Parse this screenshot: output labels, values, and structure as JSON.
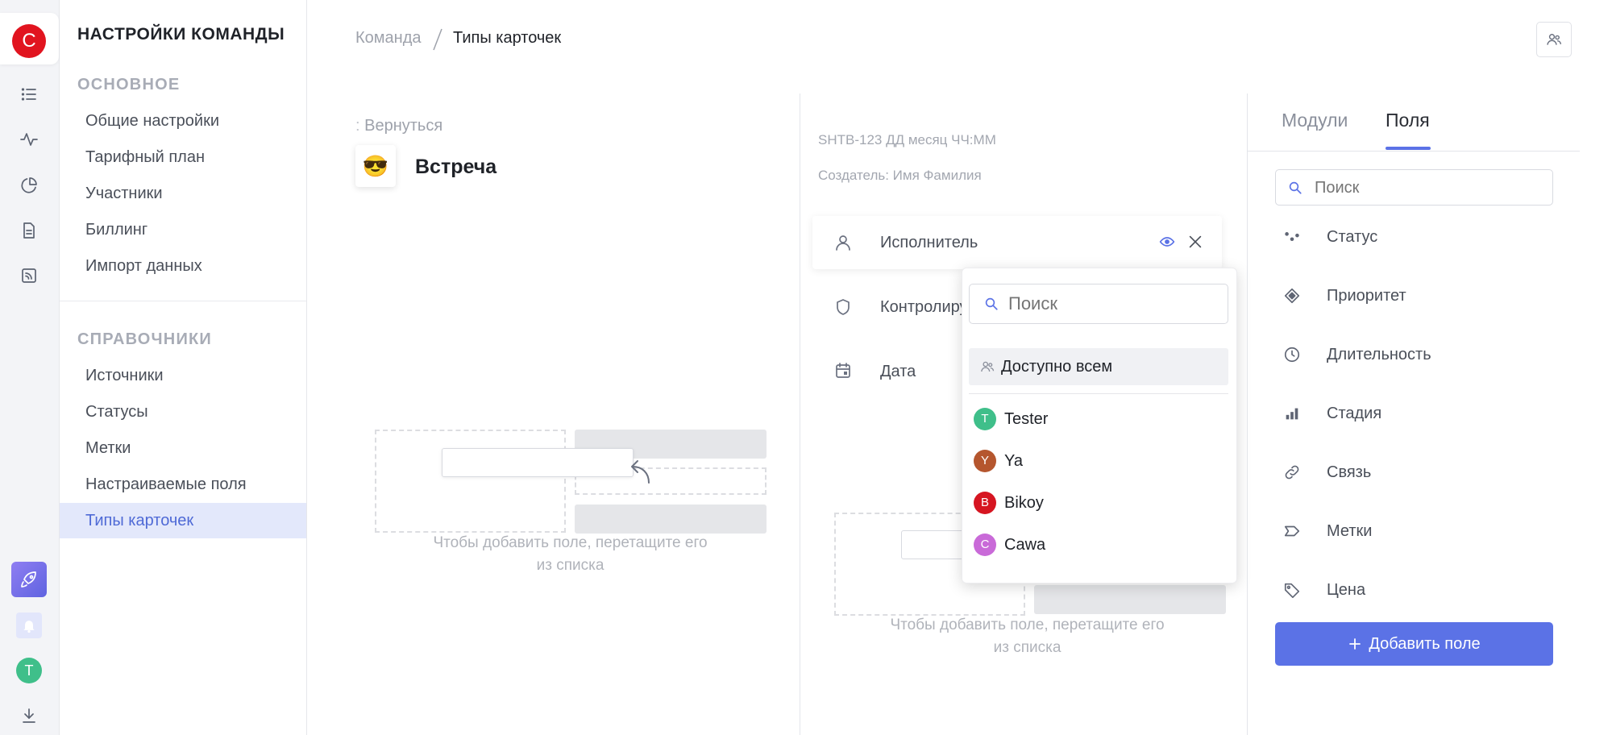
{
  "rail": {
    "logo_letter": "C",
    "user_letter": "T",
    "accent": "#e1141f"
  },
  "sidebar": {
    "title": "НАСТРОЙКИ КОМАНДЫ",
    "section_main": "ОСНОВНОЕ",
    "main_items": [
      "Общие настройки",
      "Тарифный план",
      "Участники",
      "Биллинг",
      "Импорт данных"
    ],
    "section_refs": "СПРАВОЧНИКИ",
    "ref_items": [
      "Источники",
      "Статусы",
      "Метки",
      "Настраиваемые поля",
      "Типы карточек"
    ],
    "active_item": "Типы карточек"
  },
  "breadcrumb": {
    "parent": "Команда",
    "separator": "/",
    "current": "Типы карточек"
  },
  "card_type": {
    "back_label": "Вернуться",
    "emoji": "😎",
    "name": "Встреча",
    "drop_hint_line1": "Чтобы добавить поле, перетащите его",
    "drop_hint_line2": "из списка"
  },
  "preview": {
    "id_line": "SHTB-123 ДД месяц ЧЧ:ММ",
    "creator_line": "Создатель: Имя Фамилия",
    "fields": [
      {
        "label": "Исполнитель",
        "icon": "user-icon"
      },
      {
        "label": "Контролирующий",
        "icon": "shield-icon"
      },
      {
        "label": "Дата",
        "icon": "calendar-icon"
      }
    ],
    "drop_hint_line1": "Чтобы добавить поле, перетащите его",
    "drop_hint_line2": "из списка"
  },
  "dropdown": {
    "search_placeholder": "Поиск",
    "everyone_label": "Доступно всем",
    "users": [
      {
        "letter": "T",
        "name": "Tester",
        "color": "#3fbf8a"
      },
      {
        "letter": "Y",
        "name": "Ya",
        "color": "#b5562e"
      },
      {
        "letter": "B",
        "name": "Bikoy",
        "color": "#d61521"
      },
      {
        "letter": "C",
        "name": "Cawa",
        "color": "#c96ad8"
      }
    ]
  },
  "right_panel": {
    "tabs": [
      "Модули",
      "Поля"
    ],
    "active_tab": "Поля",
    "search_placeholder": "Поиск",
    "fields": [
      {
        "label": "Статус",
        "icon": "status-dots-icon"
      },
      {
        "label": "Приоритет",
        "icon": "priority-diamond-icon"
      },
      {
        "label": "Длительность",
        "icon": "clock-icon"
      },
      {
        "label": "Стадия",
        "icon": "bar-chart-icon"
      },
      {
        "label": "Связь",
        "icon": "link-icon"
      },
      {
        "label": "Метки",
        "icon": "label-tag-icon"
      },
      {
        "label": "Цена",
        "icon": "price-tag-icon"
      }
    ],
    "add_button": "Добавить поле",
    "accent": "#5b72e6"
  }
}
